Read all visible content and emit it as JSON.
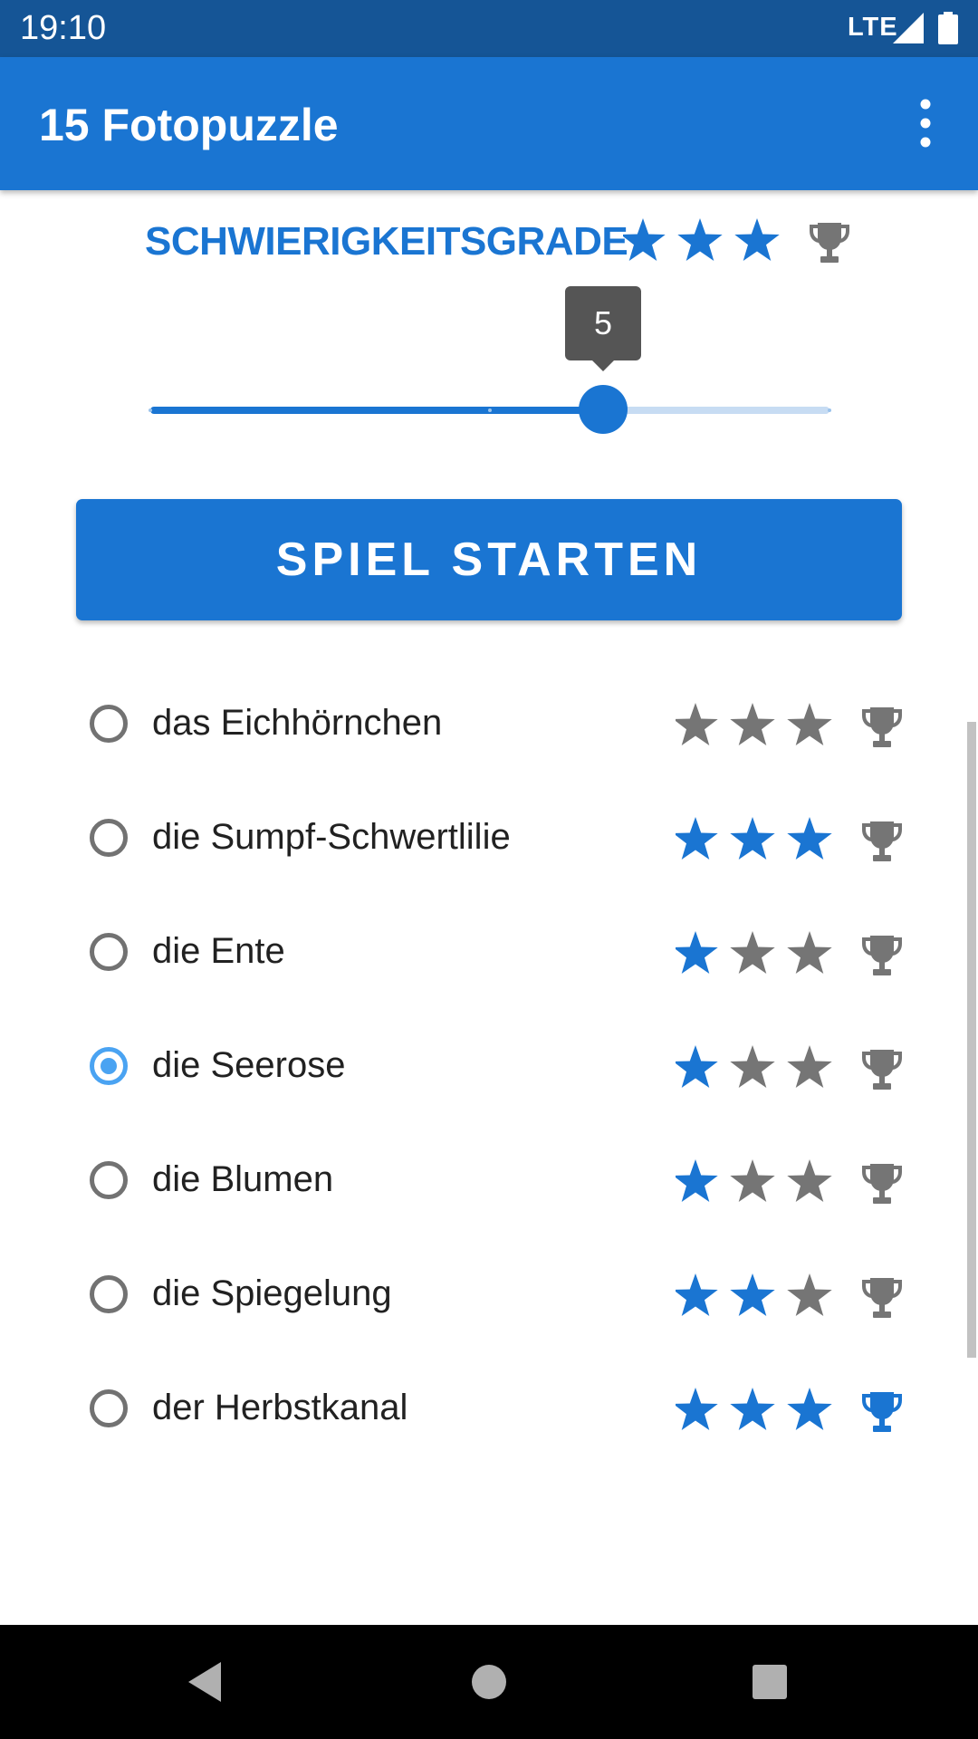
{
  "status_bar": {
    "time": "19:10",
    "network": "LTE"
  },
  "app_bar": {
    "title": "15 Fotopuzzle",
    "overflow_icon": "more-vert-icon"
  },
  "difficulty": {
    "title": "SCHWIERIGKEITSGRADE",
    "stars_earned": 3,
    "stars_total": 3,
    "trophy_earned": false
  },
  "slider": {
    "value_label": "5",
    "value": 5,
    "min": 1,
    "max": 7,
    "steps": [
      1,
      4,
      7
    ]
  },
  "start_button": {
    "label": "SPIEL STARTEN"
  },
  "puzzles": [
    {
      "label": "das Eichhörnchen",
      "selected": false,
      "stars": 0,
      "trophy": false
    },
    {
      "label": "die Sumpf-Schwertlilie",
      "selected": false,
      "stars": 3,
      "trophy": false
    },
    {
      "label": "die Ente",
      "selected": false,
      "stars": 1,
      "trophy": false
    },
    {
      "label": "die Seerose",
      "selected": true,
      "stars": 1,
      "trophy": false
    },
    {
      "label": "die Blumen",
      "selected": false,
      "stars": 1,
      "trophy": false
    },
    {
      "label": "die Spiegelung",
      "selected": false,
      "stars": 2,
      "trophy": false
    },
    {
      "label": "der Herbstkanal",
      "selected": false,
      "stars": 3,
      "trophy": true
    }
  ],
  "colors": {
    "primary": "#1a75d2",
    "status_bar": "#155596",
    "inactive_icon": "#757575",
    "radio_selected": "#4aa3f2",
    "slider_inactive": "#c7dcf3"
  },
  "nav_bar": {
    "back_icon": "back-triangle-icon",
    "home_icon": "home-circle-icon",
    "recents_icon": "recents-square-icon"
  }
}
